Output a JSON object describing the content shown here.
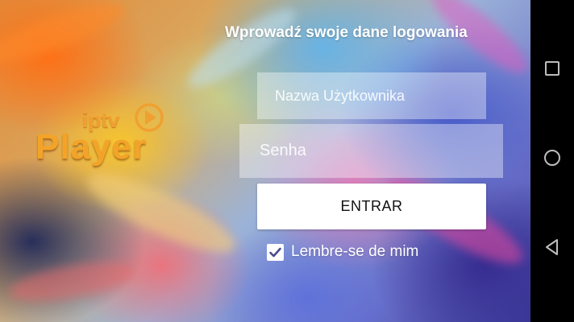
{
  "login": {
    "title": "Wprowadź swoje dane logowania",
    "username_placeholder": "Nazwa Użytkownika",
    "password_placeholder": "Senha",
    "submit_label": "ENTRAR",
    "remember_label": "Lembre-se de mim",
    "remember_checked": true
  },
  "logo": {
    "line1": "iptv",
    "line2": "Player",
    "color": "#f3a428"
  },
  "navbar": {
    "buttons": [
      "recents-square-icon",
      "home-circle-icon",
      "back-triangle-icon"
    ],
    "icon_color": "#bdbdbd"
  }
}
